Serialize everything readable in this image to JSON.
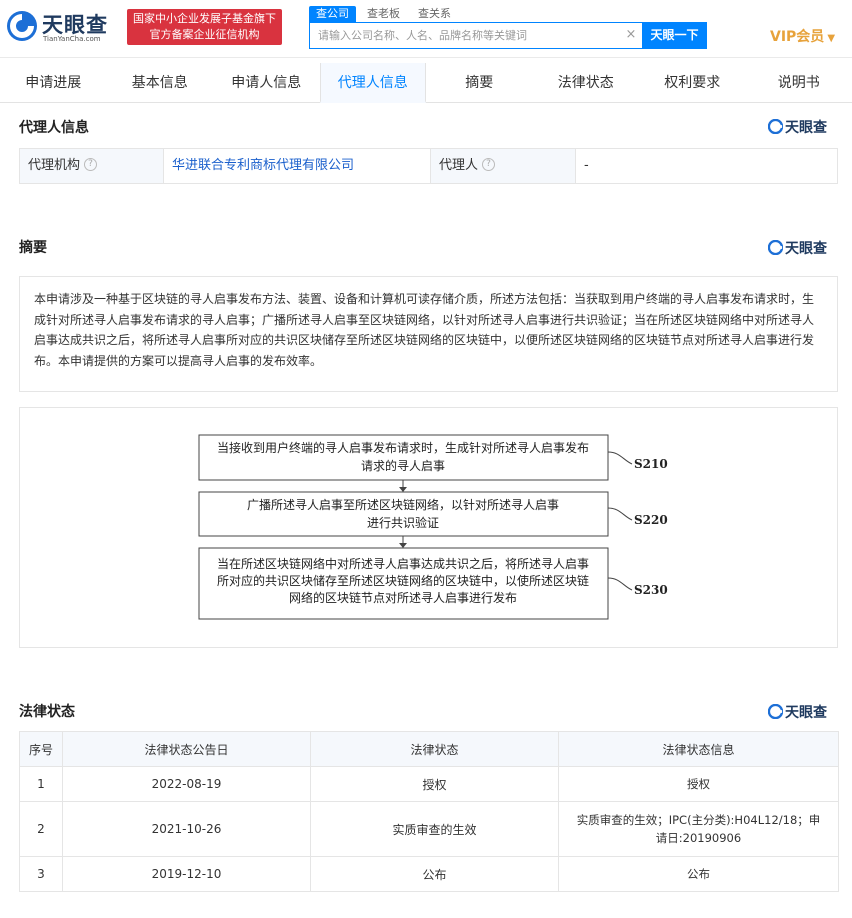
{
  "header": {
    "logo_cn": "天眼查",
    "logo_en": "TianYanCha.com",
    "badge_line1": "国家中小企业发展子基金旗下",
    "badge_line2": "官方备案企业征信机构",
    "search_tabs": [
      "查公司",
      "查老板",
      "查关系"
    ],
    "search_placeholder": "请输入公司名称、人名、品牌名称等关键词",
    "search_button": "天眼一下",
    "vip_label": "VIP会员"
  },
  "nav": {
    "tabs": [
      "申请进展",
      "基本信息",
      "申请人信息",
      "代理人信息",
      "摘要",
      "法律状态",
      "权利要求",
      "说明书"
    ],
    "active": "代理人信息"
  },
  "agent_section": {
    "title": "代理人信息",
    "watermark": "天眼查",
    "agency_label": "代理机构",
    "agency_value": "华进联合专利商标代理有限公司",
    "agent_label": "代理人",
    "agent_value": "-"
  },
  "abstract_section": {
    "title": "摘要",
    "watermark": "天眼查",
    "text": "本申请涉及一种基于区块链的寻人启事发布方法、装置、设备和计算机可读存储介质，所述方法包括：当获取到用户终端的寻人启事发布请求时，生成针对所述寻人启事发布请求的寻人启事；广播所述寻人启事至区块链网络，以针对所述寻人启事进行共识验证；当在所述区块链网络中对所述寻人启事达成共识之后，将所述寻人启事所对应的共识区块储存至所述区块链网络的区块链中，以便所述区块链网络的区块链节点对所述寻人启事进行发布。本申请提供的方案可以提高寻人启事的发布效率。"
  },
  "flowchart": {
    "steps": [
      {
        "line1": "当接收到用户终端的寻人启事发布请求时，生成针对所述寻人启事发布",
        "line2": "请求的寻人启事",
        "line3": "",
        "label": "S210"
      },
      {
        "line1": "广播所述寻人启事至所述区块链网络，以针对所述寻人启事",
        "line2": "进行共识验证",
        "line3": "",
        "label": "S220"
      },
      {
        "line1": "当在所述区块链网络中对所述寻人启事达成共识之后，将所述寻人启事",
        "line2": "所对应的共识区块储存至所述区块链网络的区块链中，以使所述区块链",
        "line3": "网络的区块链节点对所述寻人启事进行发布",
        "label": "S230"
      }
    ]
  },
  "legal_section": {
    "title": "法律状态",
    "watermark": "天眼查",
    "columns": [
      "序号",
      "法律状态公告日",
      "法律状态",
      "法律状态信息"
    ],
    "rows": [
      {
        "no": "1",
        "date": "2022-08-19",
        "status": "授权",
        "info_line1": "授权",
        "info_line2": ""
      },
      {
        "no": "2",
        "date": "2021-10-26",
        "status": "实质审查的生效",
        "info_line1": "实质审查的生效；IPC(主分类):H04L12/18；申",
        "info_line2": "请日:20190906"
      },
      {
        "no": "3",
        "date": "2019-12-10",
        "status": "公布",
        "info_line1": "公布",
        "info_line2": ""
      }
    ]
  },
  "colors": {
    "brand_blue": "#0084ff",
    "badge_red": "#d9333f",
    "vip_gold": "#e7a23b",
    "link_blue": "#1a5fcc"
  }
}
